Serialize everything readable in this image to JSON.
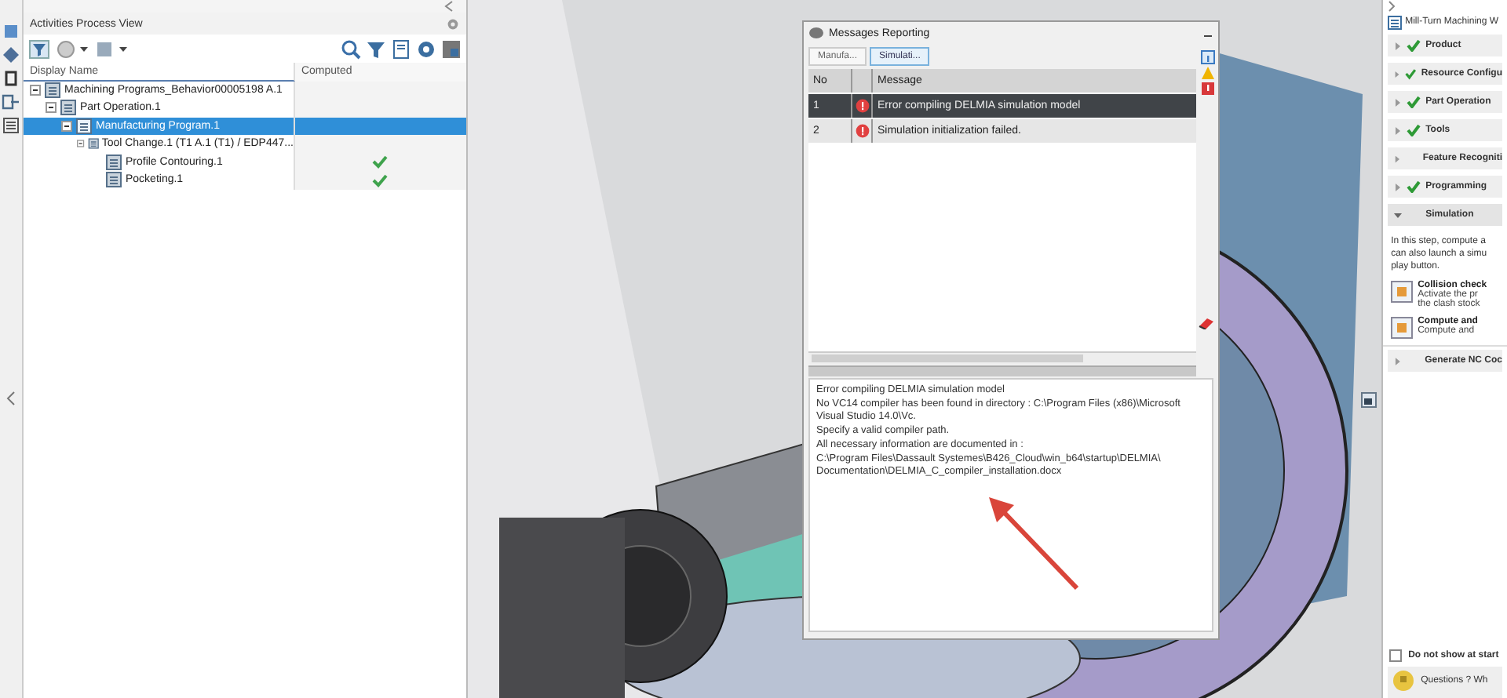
{
  "left_panel": {
    "title": "Activities Process View",
    "columns": [
      "Display Name",
      "Computed"
    ],
    "tree": [
      {
        "label": "Machining Programs_Behavior00005198 A.1",
        "selected": false,
        "computed": false,
        "children": [
          {
            "label": "Part Operation.1",
            "selected": false,
            "computed": false,
            "children": [
              {
                "label": "Manufacturing Program.1",
                "selected": true,
                "computed": false,
                "children": [
                  {
                    "label": "Tool Change.1 (T1 A.1 (T1) / EDP447...",
                    "selected": false,
                    "computed": false,
                    "children": [
                      {
                        "label": "Profile Contouring.1",
                        "selected": false,
                        "computed": true
                      },
                      {
                        "label": "Pocketing.1",
                        "selected": false,
                        "computed": true
                      }
                    ]
                  }
                ]
              }
            ]
          }
        ]
      }
    ]
  },
  "messages": {
    "title": "Messages Reporting",
    "tabs": [
      {
        "label": "Manufa...",
        "selected": false
      },
      {
        "label": "Simulati...",
        "selected": true
      }
    ],
    "columns": [
      "No",
      "Message"
    ],
    "rows": [
      {
        "no": "1",
        "message": "Error compiling DELMIA simulation model",
        "selected": true
      },
      {
        "no": "2",
        "message": "Simulation initialization failed.",
        "selected": false
      }
    ],
    "details": [
      "Error compiling DELMIA simulation model",
      "No VC14 compiler has been found in directory : C:\\Program Files (x86)\\Microsoft Visual Studio 14.0\\Vc.",
      "Specify a valid compiler path.",
      "All necessary information are documented in :",
      "C:\\Program Files\\Dassault Systemes\\B426_Cloud\\win_b64\\startup\\DELMIA\\ Documentation\\DELMIA_C_compiler_installation.docx"
    ]
  },
  "right_panel": {
    "title": "Mill-Turn Machining W",
    "steps": [
      {
        "label": "Product",
        "done": true,
        "expanded": false
      },
      {
        "label": "Resource Configu",
        "done": true,
        "expanded": false
      },
      {
        "label": "Part Operation",
        "done": true,
        "expanded": false
      },
      {
        "label": "Tools",
        "done": true,
        "expanded": false
      },
      {
        "label": "Feature Recogniti",
        "done": false,
        "expanded": false
      },
      {
        "label": "Programming",
        "done": true,
        "expanded": false
      },
      {
        "label": "Simulation",
        "done": false,
        "expanded": true,
        "description": [
          "In this step, compute a",
          "can also launch a simu",
          "play button."
        ],
        "actions": [
          {
            "title": "Collision check",
            "lines": [
              "Activate the pr",
              "the clash stock"
            ]
          },
          {
            "title": "Compute and",
            "lines": [
              "Compute and"
            ]
          }
        ]
      },
      {
        "label": "Generate NC Coc",
        "done": false,
        "expanded": false
      }
    ],
    "startup_option": {
      "label": "Do not show at start",
      "checked": false
    },
    "help_text": "Questions ? Wh"
  }
}
